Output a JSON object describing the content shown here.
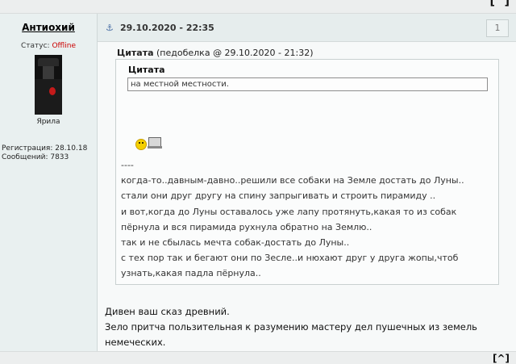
{
  "jump_top": "[^]",
  "user": {
    "name": "Антиохий",
    "status_label": "Статус:",
    "status_value": "Offline",
    "signature": "Ярила",
    "registration": "Регистрация: 28.10.18",
    "messages": "Сообщений: 7833"
  },
  "post": {
    "date": "29.10.2020 - 22:35",
    "number": "1",
    "quote_title": "Цитата",
    "quote_meta": "(педобелка @ 29.10.2020 - 21:32)",
    "inner_quote_title": "Цитата",
    "inner_quote_text": "на местной местности.",
    "quote_text": "----\nкогда-то..давным-давно..решили все собаки на Земле достать до Луны..\nстали они друг другу на спину запрыгивать и строить пирамиду ..\nи вот,когда до Луны оставалось уже лапу протянуть,какая то из собак\nпёрнула и вся пирамида рухнула обратно на Землю..\nтак и не сбылась мечта собак-достать до Луны..\nс тех пор так и бегают они по Зесле..и нюхают друг у друга жопы,чтоб\nузнать,какая падла пёрнула..",
    "reply_text": "Дивен ваш сказ древний.\nЗело притча пользительная к разумению мастеру дел пушечных из земель\nнемеческих."
  },
  "jump_bottom": "[^]",
  "colors": {
    "offline": "#cc0000",
    "anchor": "#4a6fa5"
  },
  "icons": [
    "anchor-icon",
    "smiley-icon",
    "computer-icon"
  ]
}
